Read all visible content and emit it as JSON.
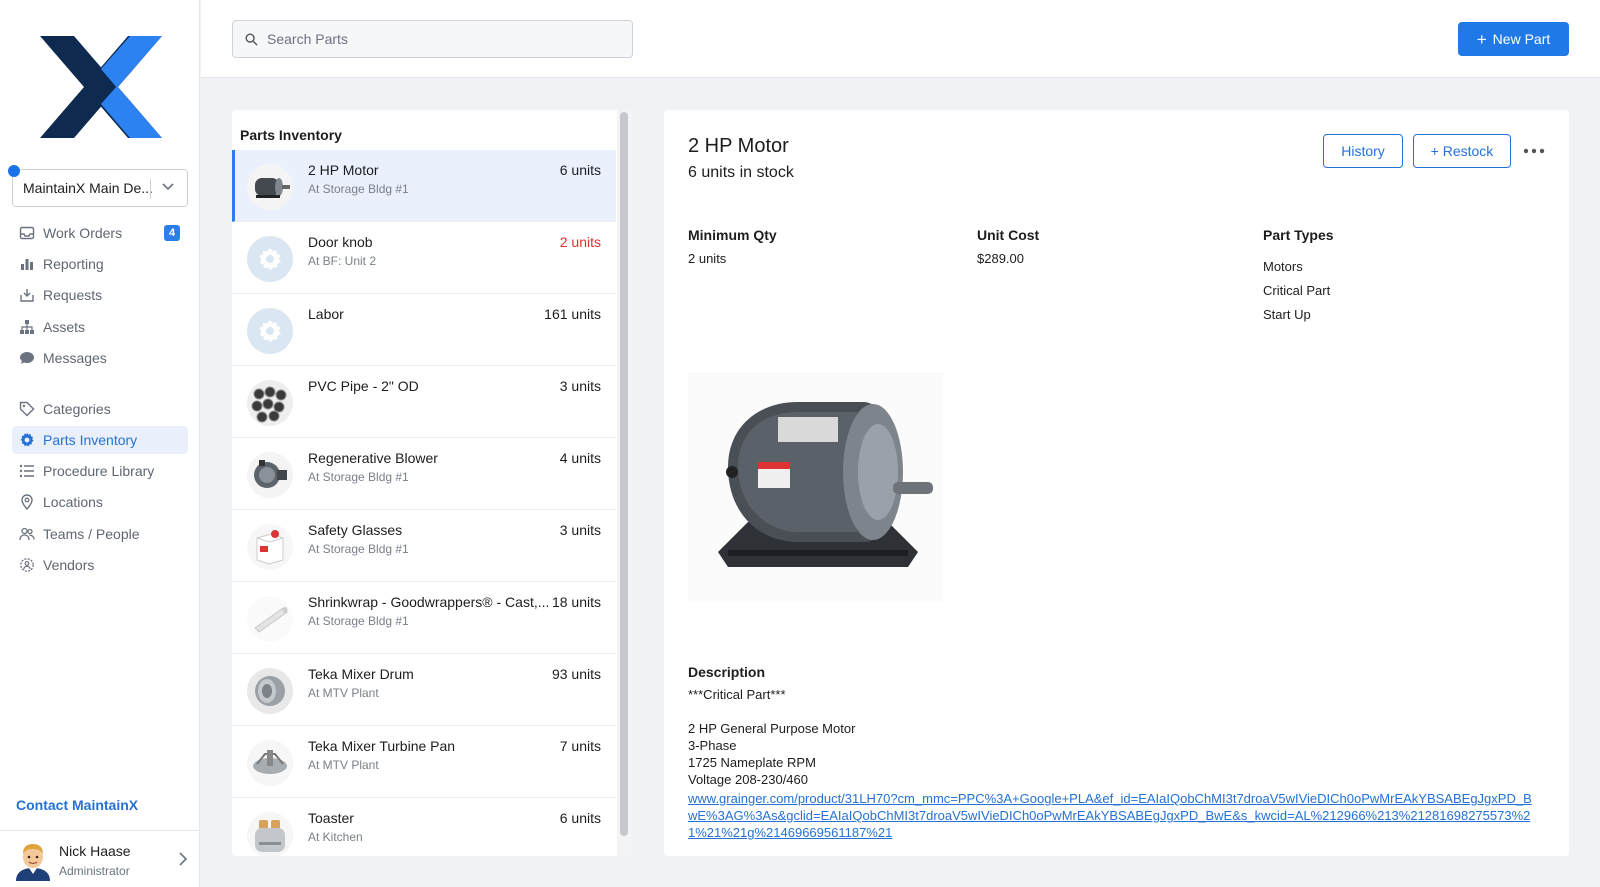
{
  "sidebar": {
    "org": "MaintainX Main De...",
    "nav": [
      {
        "label": "Work Orders",
        "icon": "inbox-icon",
        "badge": "4"
      },
      {
        "label": "Reporting",
        "icon": "bar-chart-icon"
      },
      {
        "label": "Requests",
        "icon": "tray-icon"
      },
      {
        "label": "Assets",
        "icon": "hierarchy-icon"
      },
      {
        "label": "Messages",
        "icon": "chat-icon"
      },
      {
        "label": "Categories",
        "icon": "tag-icon"
      },
      {
        "label": "Parts Inventory",
        "icon": "gear-icon",
        "active": true
      },
      {
        "label": "Procedure Library",
        "icon": "list-icon"
      },
      {
        "label": "Locations",
        "icon": "pin-icon"
      },
      {
        "label": "Teams / People",
        "icon": "people-icon"
      },
      {
        "label": "Vendors",
        "icon": "vendor-icon"
      }
    ],
    "contact": "Contact MaintainX",
    "user": {
      "name": "Nick Haase",
      "role": "Administrator"
    }
  },
  "topbar": {
    "search_placeholder": "Search Parts",
    "new_part": "New Part"
  },
  "list": {
    "title": "Parts Inventory",
    "rows": [
      {
        "name": "2 HP Motor",
        "location": "At Storage Bldg #1",
        "qty": "6 units",
        "thumb": "motor"
      },
      {
        "name": "Door knob",
        "location": "At BF: Unit 2",
        "qty": "2 units",
        "low": true,
        "thumb": "gear"
      },
      {
        "name": "Labor",
        "location": "",
        "qty": "161 units",
        "thumb": "gear"
      },
      {
        "name": "PVC Pipe - 2\" OD",
        "location": "",
        "qty": "3 units",
        "thumb": "pipes"
      },
      {
        "name": "Regenerative Blower",
        "location": "At Storage Bldg #1",
        "qty": "4 units",
        "thumb": "blower"
      },
      {
        "name": "Safety Glasses",
        "location": "At Storage Bldg #1",
        "qty": "3 units",
        "thumb": "box"
      },
      {
        "name": "Shrinkwrap - Goodwrappers® - Cast,...",
        "location": "At Storage Bldg #1",
        "qty": "18 units",
        "thumb": "roll"
      },
      {
        "name": "Teka Mixer Drum",
        "location": "At MTV Plant",
        "qty": "93 units",
        "thumb": "drum"
      },
      {
        "name": "Teka Mixer Turbine Pan",
        "location": "At MTV Plant",
        "qty": "7 units",
        "thumb": "pan"
      },
      {
        "name": "Toaster",
        "location": "At Kitchen",
        "qty": "6 units",
        "thumb": "toaster"
      }
    ]
  },
  "detail": {
    "title": "2 HP Motor",
    "stock": "6 units in stock",
    "history": "History",
    "restock": "+ Restock",
    "min_qty_label": "Minimum Qty",
    "min_qty": "2 units",
    "unit_cost_label": "Unit Cost",
    "unit_cost": "$289.00",
    "part_types_label": "Part Types",
    "part_types": [
      "Motors",
      "Critical Part",
      "Start Up"
    ],
    "description_label": "Description",
    "description": [
      "***Critical Part***",
      "",
      "2 HP General Purpose Motor",
      "3-Phase",
      "1725 Nameplate RPM",
      "Voltage 208-230/460"
    ],
    "link": "www.grainger.com/product/31LH70?cm_mmc=PPC%3A+Google+PLA&ef_id=EAIaIQobChMI3t7droaV5wIVieDICh0oPwMrEAkYBSABEgJgxPD_BwE%3AG%3As&gclid=EAIaIQobChMI3t7droaV5wIVieDICh0oPwMrEAkYBSABEgJgxPD_BwE&s_kwcid=AL%212966%213%21281698275573%21%21%21g%21469669561187%21"
  },
  "colors": {
    "accent": "#1f7ae8",
    "danger": "#e0332b",
    "logo_dark": "#0f2a4f"
  }
}
